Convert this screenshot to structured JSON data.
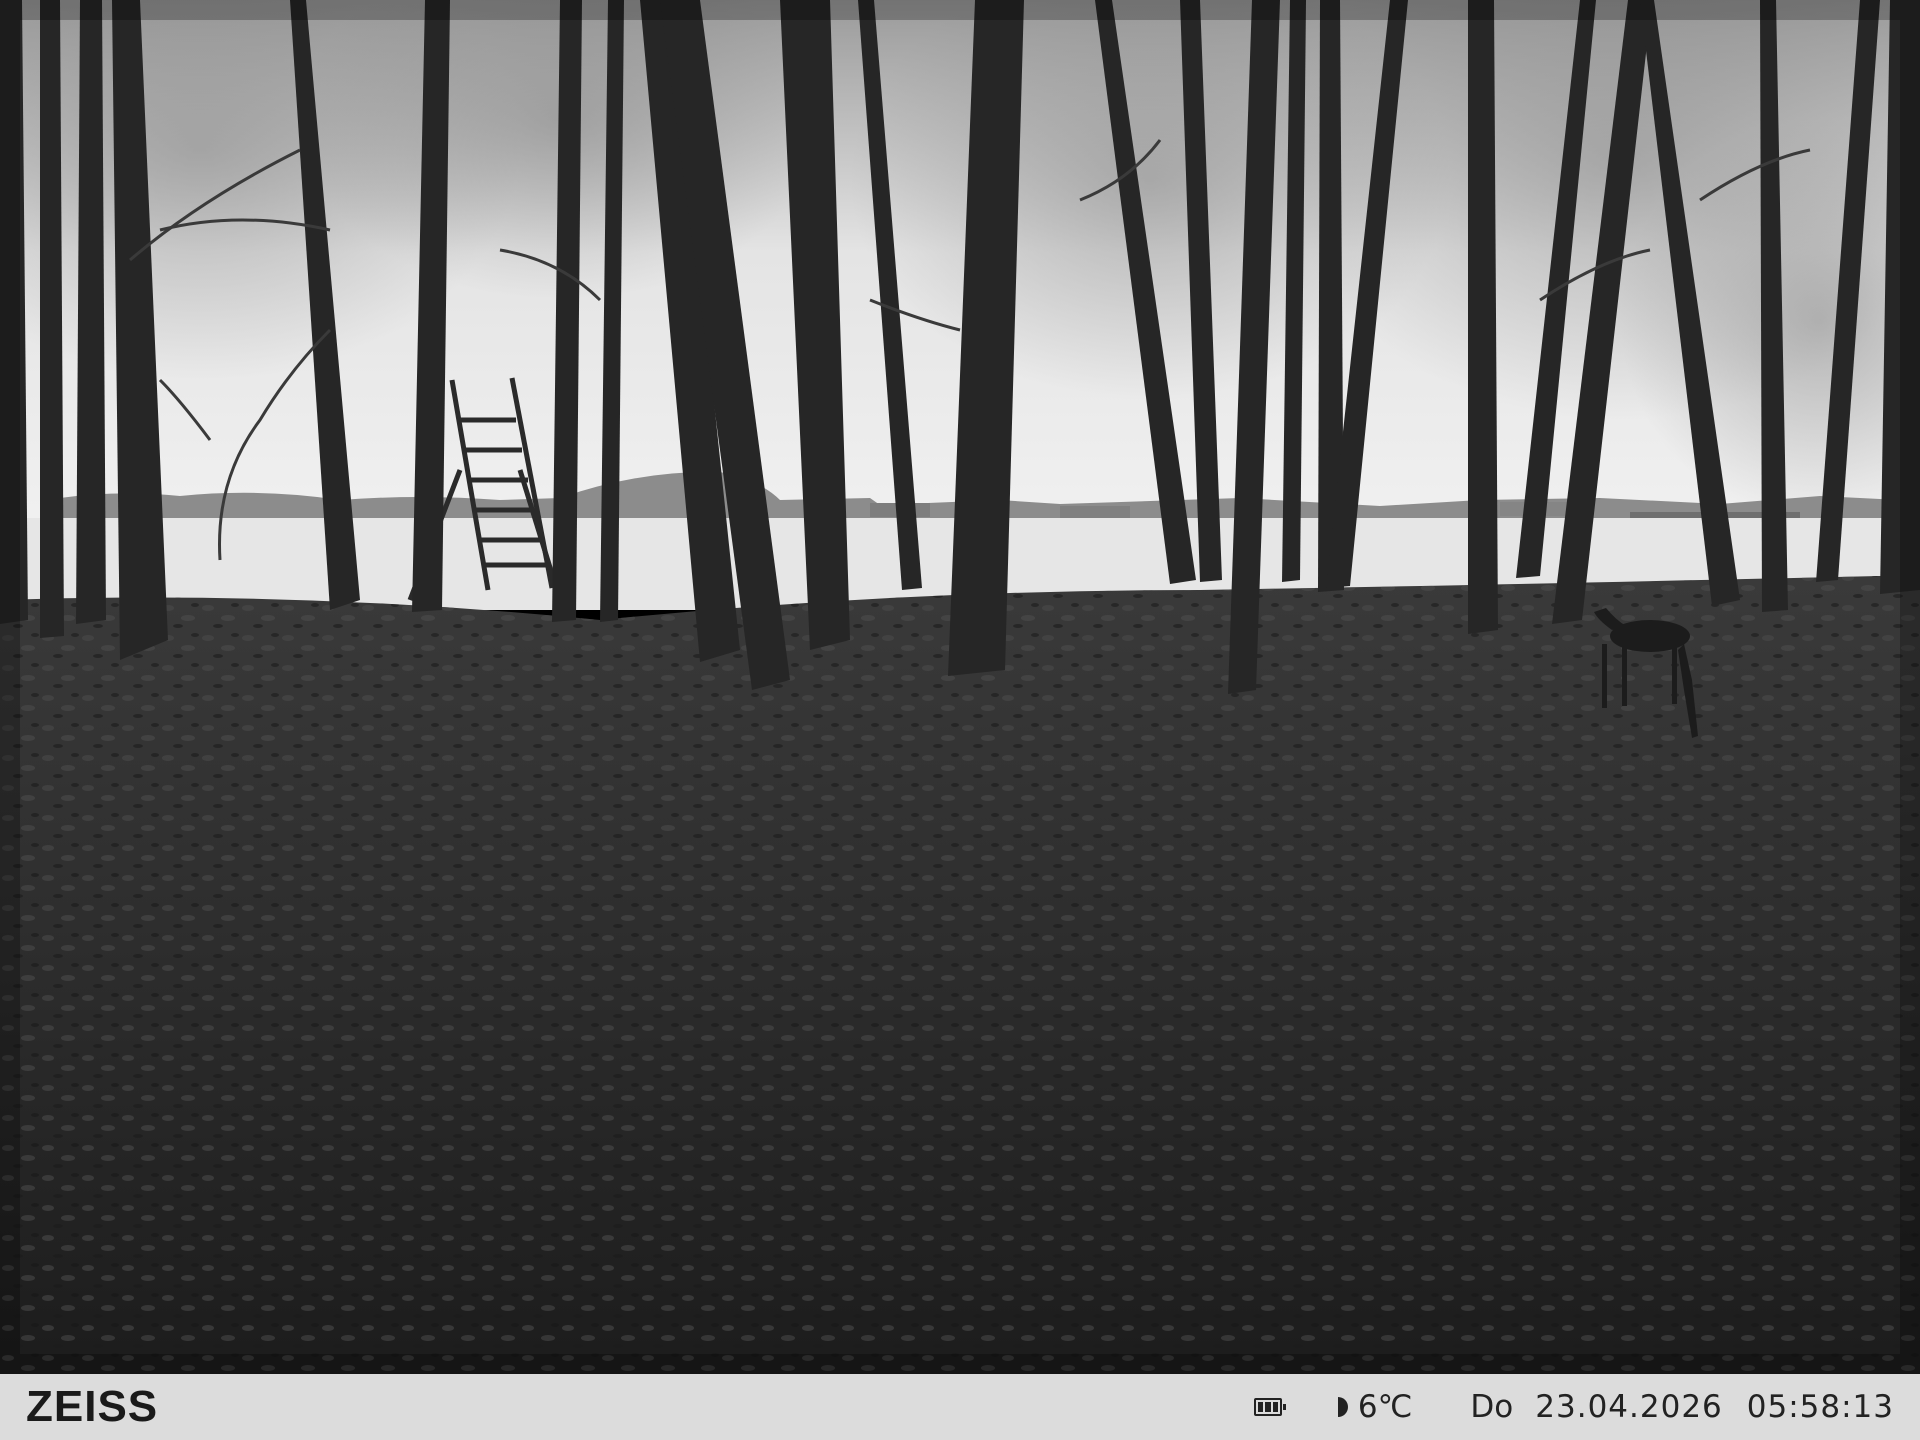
{
  "infobar": {
    "brand": "ZEISS",
    "battery_icon": "battery-full-icon",
    "moon_icon": "half-moon-icon",
    "temperature": "6℃",
    "weekday": "Do",
    "date": "23.04.2026",
    "time": "05:58:13"
  },
  "colors": {
    "infobar_background": "#dcdcdc",
    "infobar_text": "#1a1a1a"
  }
}
